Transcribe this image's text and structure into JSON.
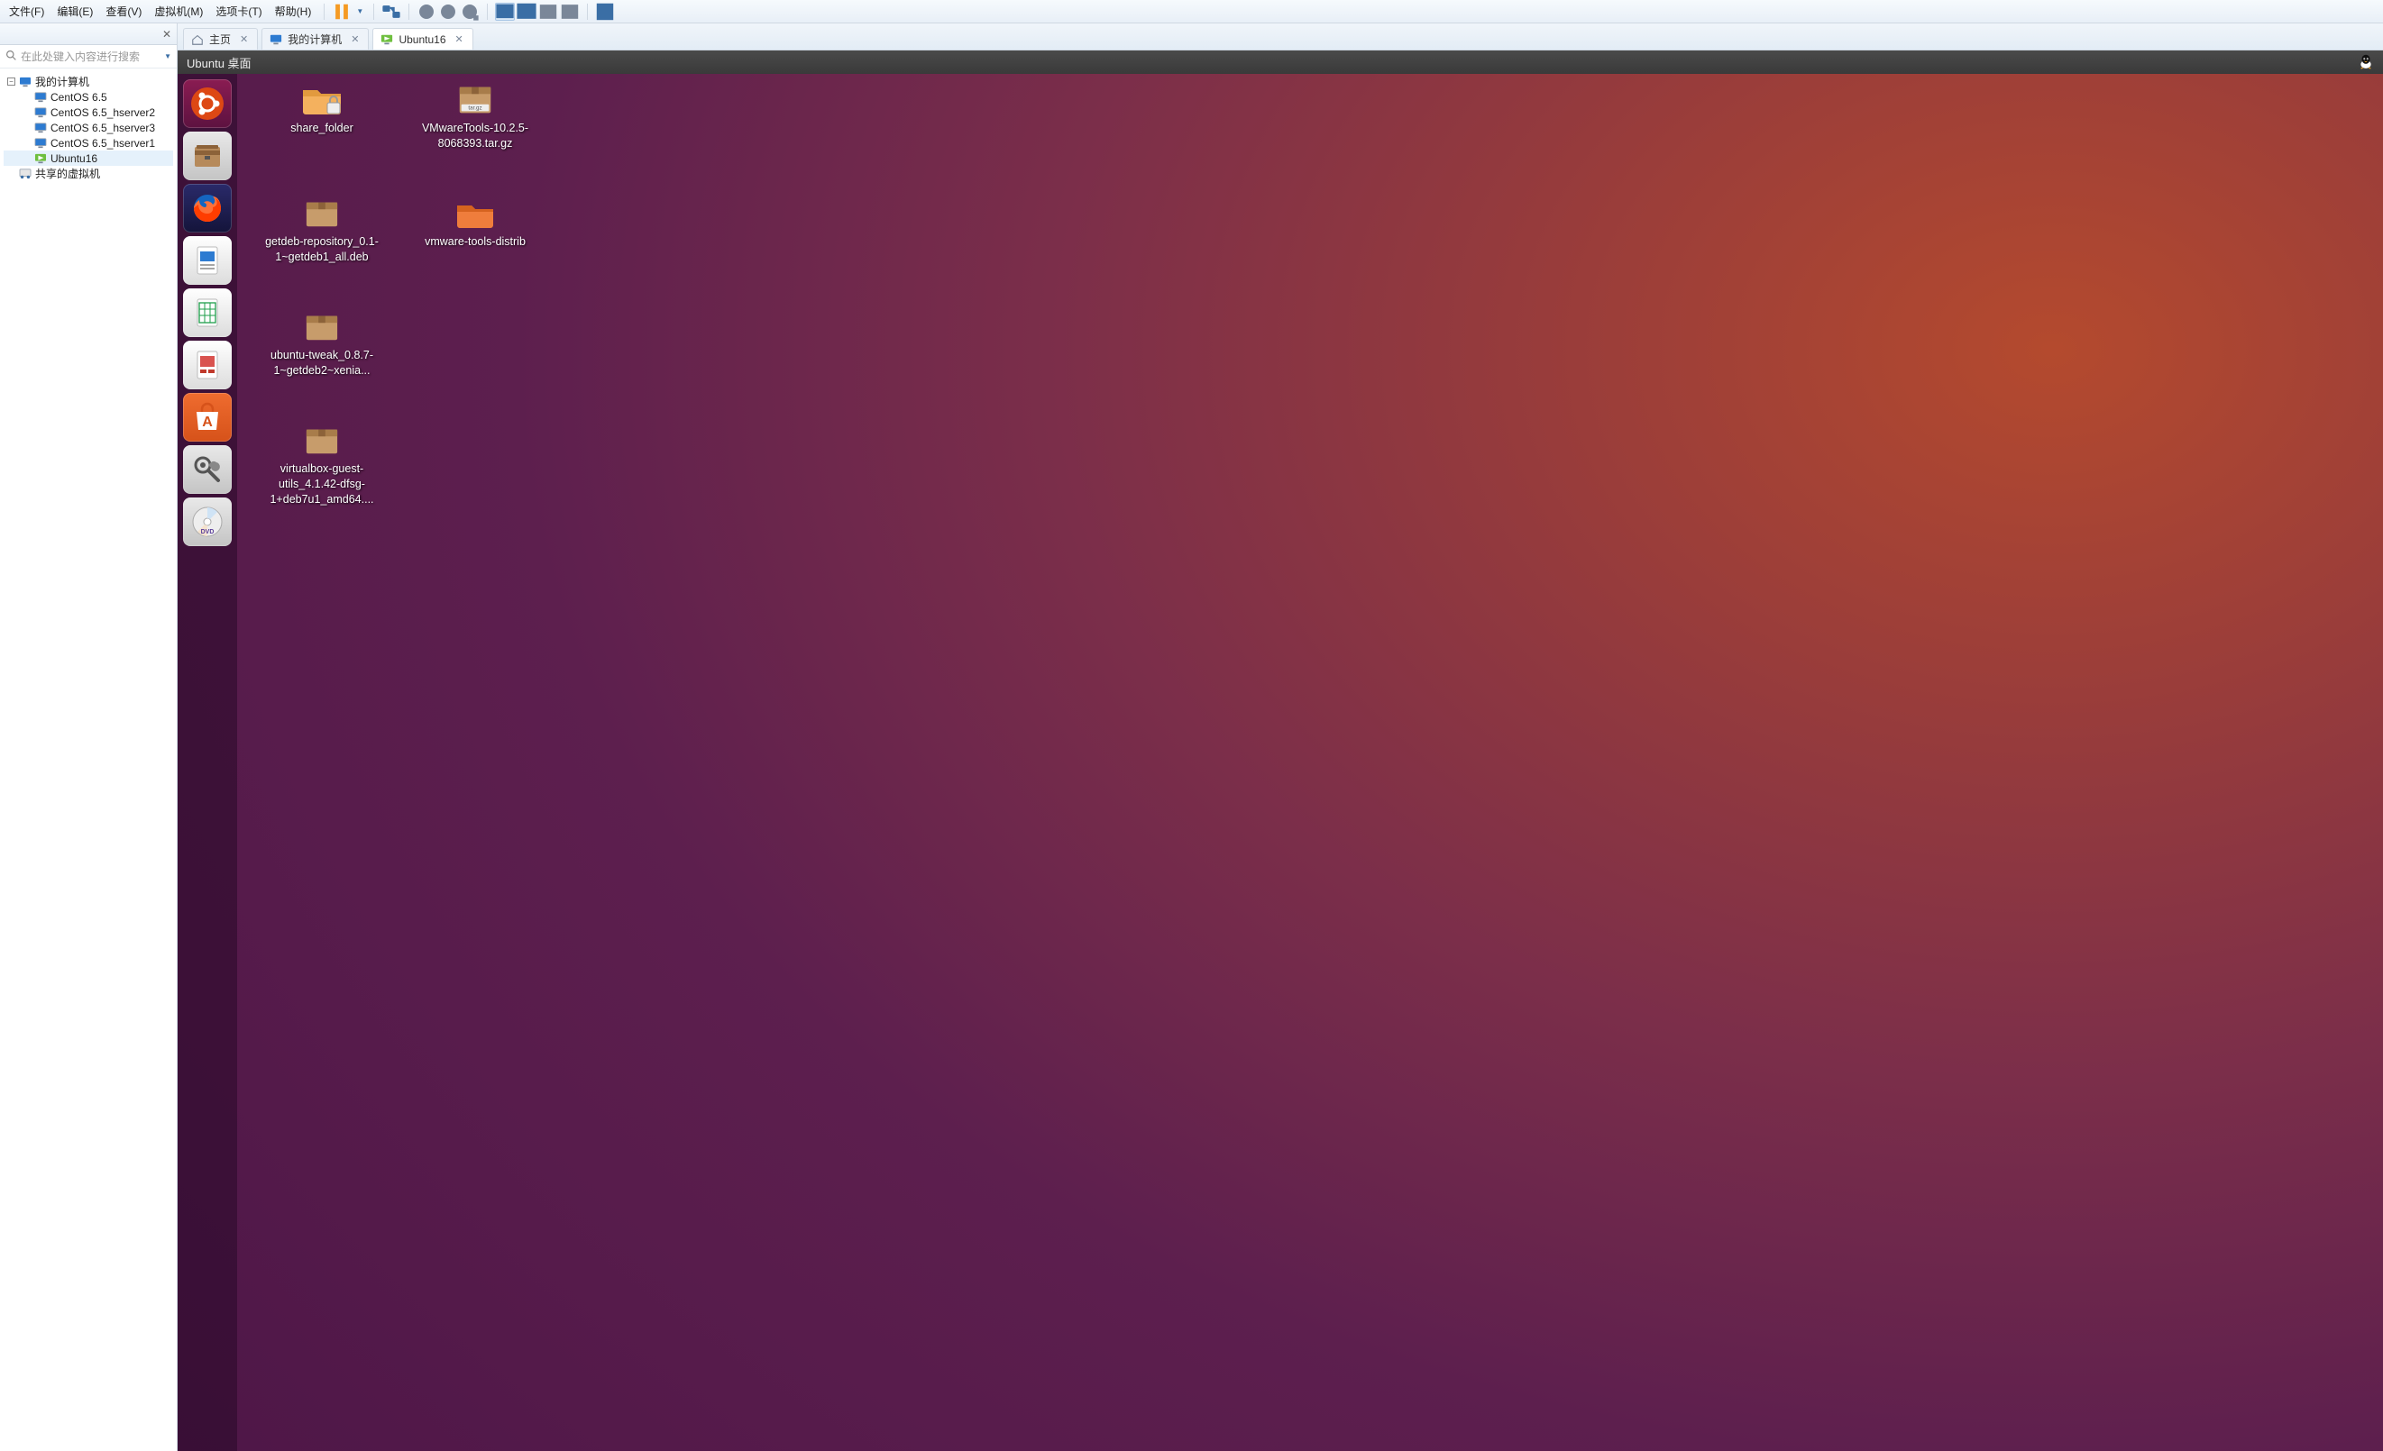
{
  "menubar": {
    "items": [
      "文件(F)",
      "编辑(E)",
      "查看(V)",
      "虚拟机(M)",
      "选项卡(T)",
      "帮助(H)"
    ]
  },
  "library": {
    "title": "",
    "search_placeholder": "在此处键入内容进行搜索",
    "root": "我的计算机",
    "vms": [
      "CentOS 6.5",
      "CentOS 6.5_hserver2",
      "CentOS 6.5_hserver3",
      "CentOS 6.5_hserver1",
      "Ubuntu16"
    ],
    "shared": "共享的虚拟机"
  },
  "tabs": {
    "home": "主页",
    "mypc": "我的计算机",
    "vm": "Ubuntu16"
  },
  "vm_title": "Ubuntu 桌面",
  "desktop_files": [
    {
      "kind": "locked-folder",
      "label": "share_folder"
    },
    {
      "kind": "targz",
      "label": "VMwareTools-10.2.5-8068393.tar.gz"
    },
    {
      "kind": "package",
      "label": "getdeb-repository_0.1-1~getdeb1_all.deb"
    },
    {
      "kind": "folder",
      "label": "vmware-tools-distrib"
    },
    {
      "kind": "package",
      "label": "ubuntu-tweak_0.8.7-1~getdeb2~xenia..."
    },
    {
      "kind": "spacer",
      "label": ""
    },
    {
      "kind": "package",
      "label": "virtualbox-guest-utils_4.1.42-dfsg-1+deb7u1_amd64...."
    }
  ],
  "launcher": [
    "ubuntu-dash",
    "files",
    "firefox",
    "writer",
    "calc",
    "impress",
    "software",
    "settings",
    "dvd"
  ]
}
